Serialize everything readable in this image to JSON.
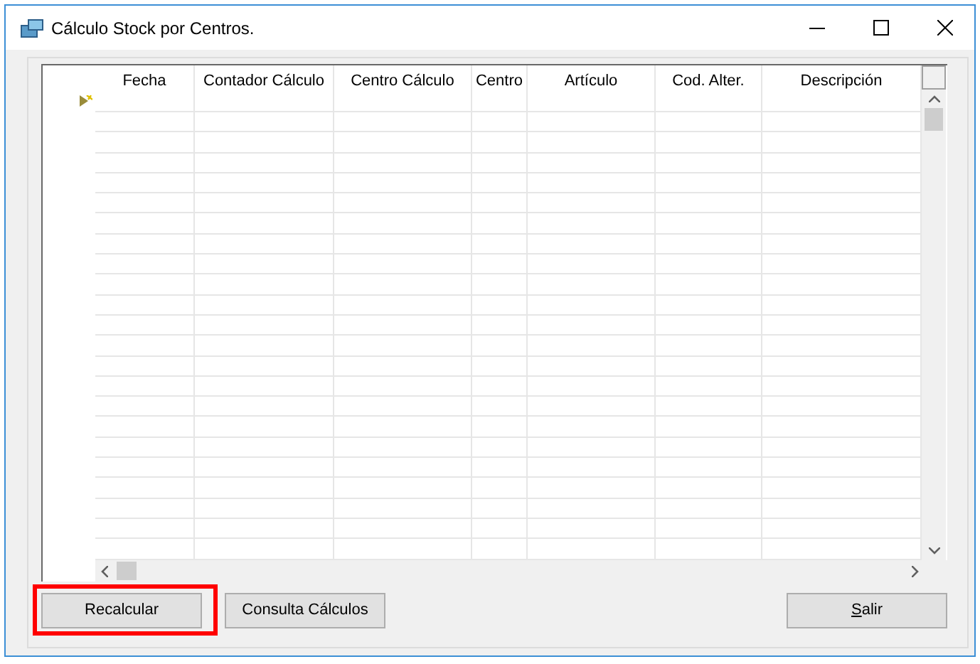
{
  "window": {
    "title": "Cálculo Stock por Centros."
  },
  "grid": {
    "columns": [
      "Fecha",
      "Contador Cálculo",
      "Centro Cálculo",
      "Centro",
      "Artículo",
      "Cod. Alter.",
      "Descripción"
    ]
  },
  "buttons": [
    {
      "label": "Recalcular",
      "highlighted": true,
      "underline_first": false
    },
    {
      "label": "Consulta Cálculos",
      "highlighted": false,
      "underline_first": false
    },
    {
      "label": "Salir",
      "highlighted": false,
      "underline_first": true
    }
  ]
}
